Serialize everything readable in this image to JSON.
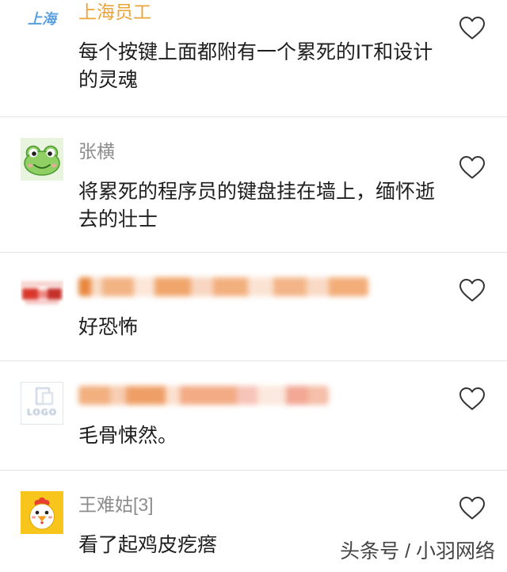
{
  "comments": [
    {
      "avatar": {
        "text": "上海",
        "color": "#5a9fdf"
      },
      "name": "上海员工",
      "name_color": "#eca43a",
      "lines": [
        "每个按键上面都附有一个累死的IT和设计",
        "的灵魂"
      ],
      "like_icon": "heart-outline-icon"
    },
    {
      "avatar": {
        "icon": "frog-avatar-icon"
      },
      "name": "张横",
      "name_color": "#8c8c8c",
      "lines": [
        "将累死的程序员的键盘挂在墙上，缅怀逝",
        "去的壮士"
      ],
      "like_icon": "heart-outline-icon"
    },
    {
      "avatar": {
        "icon": "blurred-avatar-icon"
      },
      "lines": [
        "好恐怖"
      ],
      "like_icon": "heart-outline-icon"
    },
    {
      "avatar": {
        "icon": "logo-avatar-icon",
        "text": "LOGO"
      },
      "lines": [
        "毛骨悚然。"
      ],
      "like_icon": "heart-outline-icon"
    },
    {
      "avatar": {
        "icon": "chicken-avatar-icon"
      },
      "name": "王难姑[3]",
      "name_color": "#8c8c8c",
      "lines": [
        "看了起鸡皮疙瘩"
      ],
      "like_icon": "heart-outline-icon"
    }
  ],
  "watermark": "头条号 / 小羽网络",
  "colors": {
    "background": "#ffffff",
    "comment_text": "#1e1e1e",
    "divider": "#e4e4e4",
    "like_stroke": "#333333"
  }
}
